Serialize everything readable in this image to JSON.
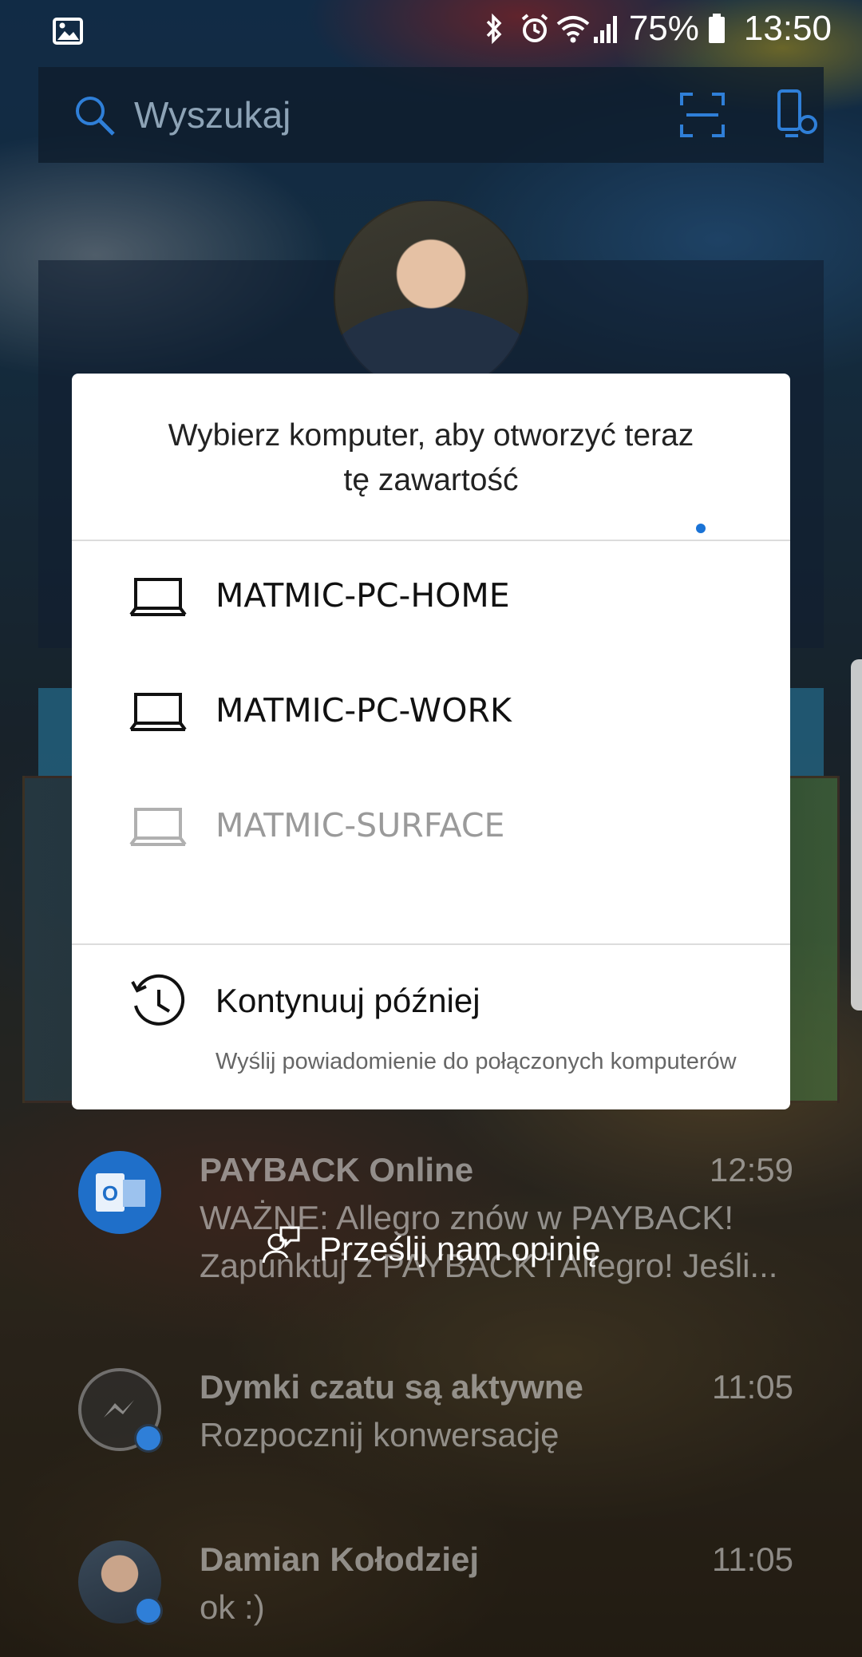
{
  "status_bar": {
    "battery": "75%",
    "time": "13:50"
  },
  "search": {
    "placeholder": "Wyszukaj"
  },
  "dialog": {
    "title_line1": "Wybierz komputer, aby otworzyć teraz",
    "title_line2": "tę zawartość",
    "devices": [
      {
        "name": "MATMIC-PC-HOME",
        "enabled": true
      },
      {
        "name": "MATMIC-PC-WORK",
        "enabled": true
      },
      {
        "name": "MATMIC-SURFACE",
        "enabled": false
      }
    ],
    "continue_later": {
      "label": "Kontynuuj później",
      "subtitle": "Wyślij powiadomienie do połączonych komputerów"
    }
  },
  "feedback": {
    "label": "Prześlij nam opinię"
  },
  "notifications": [
    {
      "app_icon": "outlook-icon",
      "title": "PAYBACK Online",
      "time": "12:59",
      "lines": [
        "WAŻNE: Allegro znów w PAYBACK!",
        "Zapunktuj z PAYBACK i Allegro! Jeśli..."
      ]
    },
    {
      "app_icon": "messenger-icon",
      "title": "Dymki czatu są aktywne",
      "time": "11:05",
      "lines": [
        "Rozpocznij konwersację"
      ]
    },
    {
      "app_icon": "contact-avatar",
      "title": "Damian Kołodziej",
      "time": "11:05",
      "lines": [
        "ok :)"
      ]
    }
  ],
  "colors": {
    "accent": "#1a73d6",
    "dialog_bg": "#ffffff",
    "disabled_text": "#9a9a9a"
  }
}
